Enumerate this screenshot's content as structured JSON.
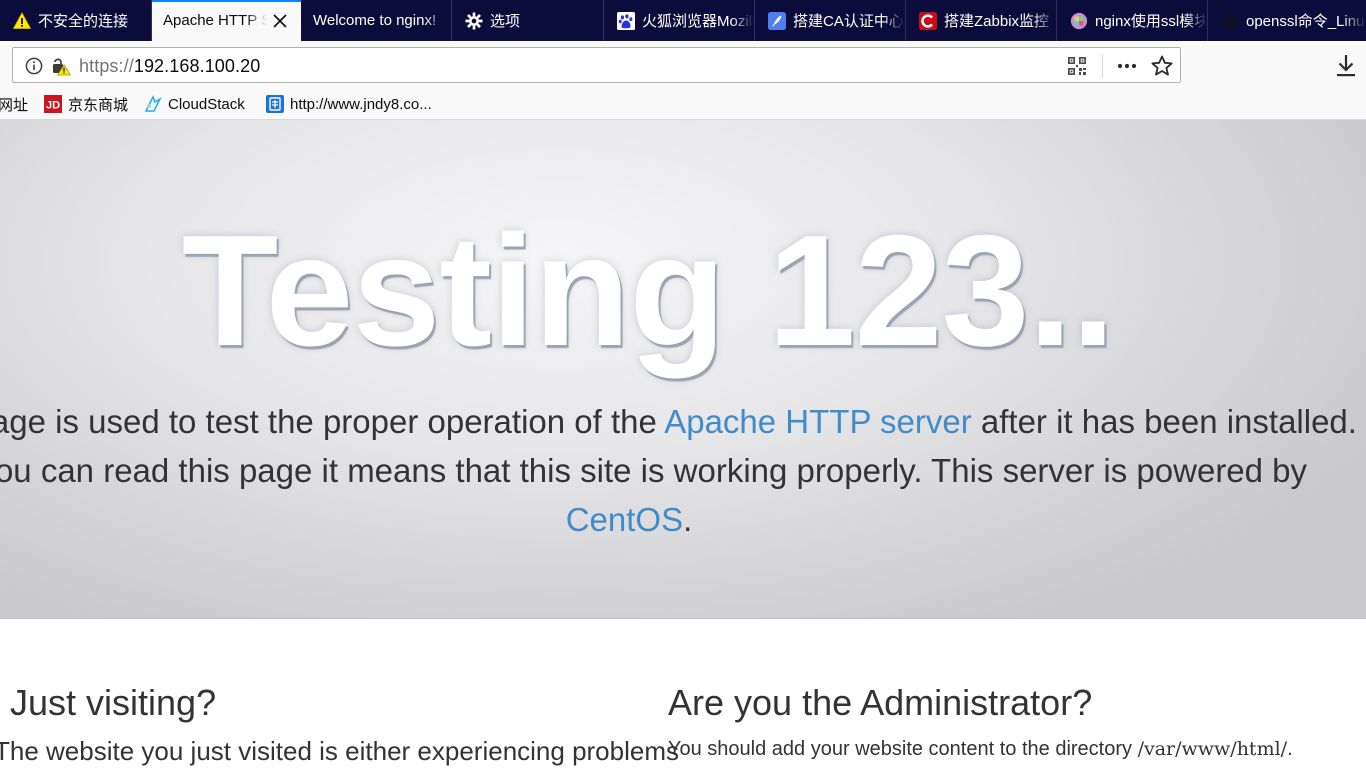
{
  "tabs": [
    {
      "label": "不安全的连接",
      "icon": "warning-triangle-icon",
      "active": false
    },
    {
      "label": "Apache HTTP Server Test Page",
      "icon": "",
      "active": true
    },
    {
      "label": "Welcome to nginx!",
      "icon": "",
      "active": false
    },
    {
      "label": "选项",
      "icon": "gear-icon",
      "active": false
    },
    {
      "label": "火狐浏览器Mozilla",
      "icon": "baidu-paw-icon",
      "active": false
    },
    {
      "label": "搭建CA认证中心",
      "icon": "feather-icon",
      "active": false
    },
    {
      "label": "搭建Zabbix监控",
      "icon": "csdn-c-icon",
      "active": false
    },
    {
      "label": "nginx使用ssl模块",
      "icon": "puzzle-avatar-icon",
      "active": false
    },
    {
      "label": "openssl命令_Linux",
      "icon": "diamond-logo-icon",
      "active": false
    }
  ],
  "urlbar": {
    "scheme": "https://",
    "host": "192.168.100.20"
  },
  "bookmarks": [
    {
      "label": "网址",
      "icon": ""
    },
    {
      "label": "京东商城",
      "icon": "jd-logo-icon"
    },
    {
      "label": "CloudStack",
      "icon": "cloudstack-logo-icon"
    },
    {
      "label": "http://www.jndy8.co...",
      "icon": "bookmark-site-icon"
    }
  ],
  "page": {
    "heading": "Testing 123..",
    "lead_part1": "This page is used to test the proper operation of the ",
    "lead_link1": "Apache HTTP server",
    "lead_part2": " after it has been installed. If you can read this page it means that this site is working properly. This server is powered by ",
    "lead_link2": "CentOS",
    "lead_part3": ".",
    "left_heading": "Just visiting?",
    "left_text": "The website you just visited is either experiencing problems",
    "right_heading": "Are you the Administrator?",
    "right_text": "You should add your website content to the directory ",
    "right_code": "/var/www/html/",
    "right_suffix": "."
  },
  "colors": {
    "tabstrip": "#0c0c3c",
    "active_tab_line": "#0a84ff",
    "link": "#428bca"
  }
}
